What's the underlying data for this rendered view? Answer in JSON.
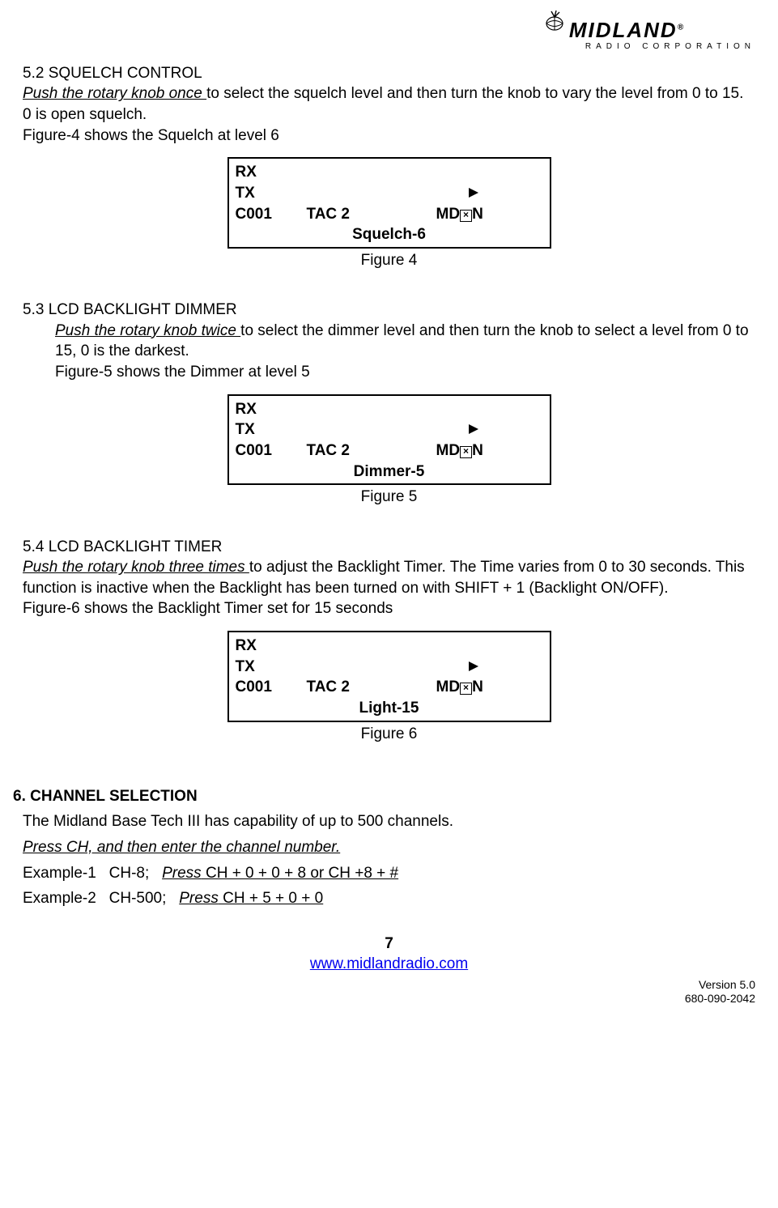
{
  "logo": {
    "brand": "MIDLAND",
    "sub": "RADIO CORPORATION",
    "reg": "®"
  },
  "s52": {
    "heading": "5.2 SQUELCH CONTROL",
    "action": "Push the rotary knob once ",
    "rest": "to select the squelch level and then turn the knob to vary the level from 0 to 15. 0 is open squelch.",
    "fig_note": "Figure-4 shows the Squelch at level 6"
  },
  "lcd_common": {
    "rx": "RX",
    "tx": "TX",
    "ch": "C001",
    "tac": "TAC 2",
    "md_pre": "MD",
    "md_post": "N"
  },
  "lcd4": {
    "status": "Squelch-6",
    "caption": "Figure 4"
  },
  "s53": {
    "heading": "5.3 LCD BACKLIGHT DIMMER",
    "action": "Push the rotary knob twice ",
    "rest": "to select the dimmer level and then turn the knob to select a level from 0 to 15, 0 is the darkest.",
    "fig_note": "Figure-5 shows the Dimmer at level 5"
  },
  "lcd5": {
    "status": "Dimmer-5",
    "caption": "Figure 5"
  },
  "s54": {
    "heading": "5.4 LCD BACKLIGHT TIMER",
    "action": "Push the rotary knob three times ",
    "rest": "to adjust the Backlight Timer. The Time varies from 0 to 30 seconds. This function is inactive when the Backlight has been turned on with SHIFT + 1 (Backlight ON/OFF).",
    "fig_note": "Figure-6 shows the Backlight Timer set for 15 seconds"
  },
  "lcd6": {
    "status": "Light-15",
    "caption": "Figure 6"
  },
  "s6": {
    "heading": "6. CHANNEL SELECTION",
    "intro": "The Midland Base Tech III has capability of up to 500 channels.",
    "instr": "Press CH, and then enter the channel number.",
    "ex1_label": "Example-1   CH-8;   ",
    "ex1_press_i": "Press",
    "ex1_press_r": " CH + 0 + 0 + 8 or CH +8 + #",
    "ex2_label": "Example-2   CH-500;   ",
    "ex2_press_i": "Press",
    "ex2_press_r": " CH + 5 + 0 + 0"
  },
  "footer": {
    "page": "7",
    "url": "www.midlandradio.com",
    "ver1": "Version 5.0",
    "ver2": "680-090-2042"
  }
}
